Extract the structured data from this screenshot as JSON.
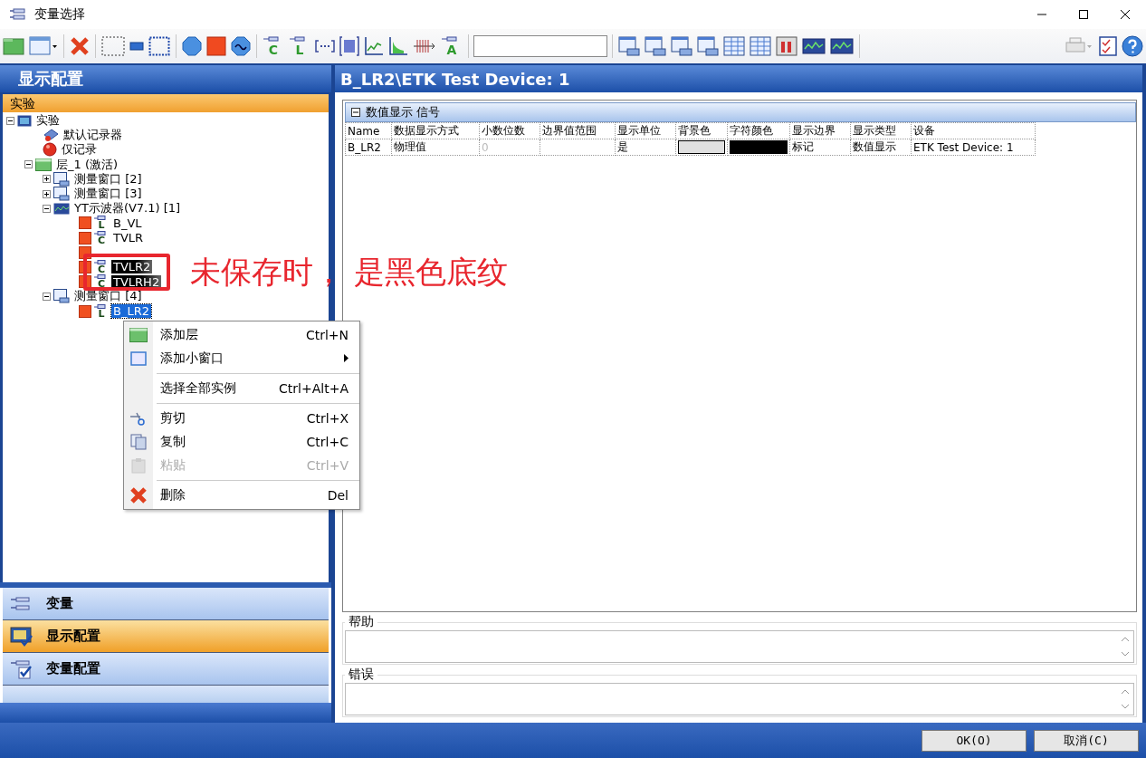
{
  "window": {
    "title": "变量选择"
  },
  "toolbar": [
    {
      "kind": "folder"
    },
    {
      "kind": "window-drop"
    },
    {
      "kind": "sep"
    },
    {
      "kind": "delete"
    },
    {
      "kind": "sep"
    },
    {
      "kind": "dotted"
    },
    {
      "kind": "small-rect"
    },
    {
      "kind": "dotted-blue"
    },
    {
      "kind": "sep"
    },
    {
      "kind": "octagon"
    },
    {
      "kind": "red-square"
    },
    {
      "kind": "wave"
    },
    {
      "kind": "sep"
    },
    {
      "kind": "var",
      "letter": "C"
    },
    {
      "kind": "var",
      "letter": "L"
    },
    {
      "kind": "bracket"
    },
    {
      "kind": "grid"
    },
    {
      "kind": "chart"
    },
    {
      "kind": "area"
    },
    {
      "kind": "comb"
    },
    {
      "kind": "var",
      "letter": "A"
    },
    {
      "kind": "sep"
    },
    {
      "kind": "field"
    },
    {
      "kind": "sep"
    },
    {
      "kind": "view"
    },
    {
      "kind": "view"
    },
    {
      "kind": "view"
    },
    {
      "kind": "view"
    },
    {
      "kind": "table"
    },
    {
      "kind": "table"
    },
    {
      "kind": "bars"
    },
    {
      "kind": "scope"
    },
    {
      "kind": "scope"
    },
    {
      "kind": "sep"
    },
    {
      "kind": "spacer"
    },
    {
      "kind": "printer"
    },
    {
      "kind": "checklist"
    },
    {
      "kind": "help"
    }
  ],
  "left_panel": {
    "title": "显示配置",
    "section": "实验",
    "tree": [
      {
        "label": "实验",
        "kind": "monitor",
        "expanded": true,
        "selected": false,
        "children": [
          {
            "label": "默认记录器",
            "kind": "recorder",
            "selected": false
          },
          {
            "label": "仅记录",
            "kind": "record",
            "selected": false
          },
          {
            "label": "层_1 (激活)",
            "kind": "layer",
            "expanded": true,
            "selected": false,
            "children": [
              {
                "label": "测量窗口 [2]",
                "kind": "window",
                "expanded": false,
                "selected": false
              },
              {
                "label": "测量窗口 [3]",
                "kind": "window",
                "expanded": false,
                "selected": false
              },
              {
                "label": "YT示波器(V7.1) [1]",
                "kind": "scope",
                "expanded": true,
                "selected": false,
                "children": [
                  {
                    "label": "B_VL",
                    "kind": "var",
                    "letter": "L",
                    "selected": false,
                    "unsaved": false
                  },
                  {
                    "label": "TVLR",
                    "kind": "var",
                    "letter": "C",
                    "selected": false,
                    "unsaved": false
                  },
                  {
                    "kind": "var",
                    "selected": false,
                    "unsaved": false
                  },
                  {
                    "label": "TVLR2",
                    "kind": "var",
                    "letter": "C",
                    "selected": false,
                    "unsaved": true
                  },
                  {
                    "label": "TVLRH2",
                    "kind": "var",
                    "letter": "C",
                    "selected": false,
                    "unsaved": true
                  }
                ]
              },
              {
                "label": "测量窗口 [4]",
                "kind": "window",
                "expanded": true,
                "selected": false,
                "children": [
                  {
                    "label": "B_LR2",
                    "kind": "var",
                    "letter": "L",
                    "selected": true,
                    "unsaved": false
                  }
                ]
              }
            ]
          }
        ]
      }
    ],
    "nav": [
      {
        "label": "变量",
        "kind": "variables",
        "selected": false
      },
      {
        "label": "显示配置",
        "kind": "display",
        "selected": true
      },
      {
        "label": "变量配置",
        "kind": "varconfig",
        "selected": false
      }
    ]
  },
  "annotation": {
    "text": "未保存时， 是黑色底纹"
  },
  "context_menu": [
    {
      "kind": "layer",
      "label": "添加层",
      "shortcut": "Ctrl+N",
      "disabled": false,
      "submenu": false
    },
    {
      "kind": "window",
      "label": "添加小窗口",
      "disabled": false,
      "submenu": true
    },
    {
      "kind": "sep"
    },
    {
      "kind": "plain",
      "label": "选择全部实例",
      "shortcut": "Ctrl+Alt+A",
      "disabled": false,
      "submenu": false
    },
    {
      "kind": "sep"
    },
    {
      "kind": "cut",
      "label": "剪切",
      "shortcut": "Ctrl+X",
      "disabled": false,
      "submenu": false
    },
    {
      "kind": "copy",
      "label": "复制",
      "shortcut": "Ctrl+C",
      "disabled": false,
      "submenu": false
    },
    {
      "kind": "paste",
      "label": "粘贴",
      "shortcut": "Ctrl+V",
      "disabled": true,
      "submenu": false
    },
    {
      "kind": "sep"
    },
    {
      "kind": "delete",
      "label": "删除",
      "shortcut": "Del",
      "disabled": false,
      "submenu": false
    }
  ],
  "right_panel": {
    "title": "B_LR2\\ETK Test Device: 1",
    "group": {
      "title": "数值显示 信号",
      "expanded": true
    },
    "table": {
      "columns": [
        "Name",
        "数据显示方式",
        "小数位数",
        "边界值范围",
        "显示单位",
        "背景色",
        "字符颜色",
        "显示边界",
        "显示类型",
        "设备"
      ],
      "rows": [
        [
          {
            "kind": "text",
            "text": "B_LR2",
            "disabled": false
          },
          {
            "kind": "text",
            "text": "物理值",
            "disabled": false
          },
          {
            "kind": "text",
            "text": "0",
            "disabled": true
          },
          {
            "kind": "empty"
          },
          {
            "kind": "text",
            "text": "是",
            "disabled": false
          },
          {
            "kind": "swatch",
            "color": "#e0e0e0"
          },
          {
            "kind": "swatch",
            "color": "#000000"
          },
          {
            "kind": "text",
            "text": "标记",
            "disabled": false
          },
          {
            "kind": "text",
            "text": "数值显示",
            "disabled": false
          },
          {
            "kind": "text",
            "text": "ETK Test Device: 1",
            "disabled": false
          }
        ]
      ]
    },
    "help": {
      "label": "帮助"
    },
    "error": {
      "label": "错误"
    }
  },
  "buttons": [
    {
      "label": "OK(O)"
    },
    {
      "label": "取消(C)"
    }
  ]
}
